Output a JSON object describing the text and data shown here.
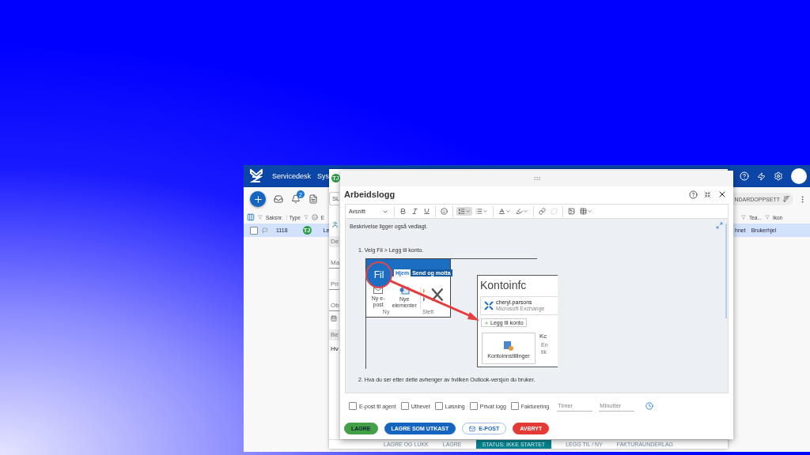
{
  "app": {
    "nav": {
      "title": "Servicedesk",
      "item_2": "Sys"
    },
    "toolbar": {
      "notification_count": "2",
      "layout_button": "NDARDOPPSETT"
    },
    "table": {
      "columns_left": [
        "Saksnr.",
        "Type",
        "E"
      ],
      "columns_right": [
        "Tea...",
        "Ikon"
      ],
      "rows": [
        {
          "selected": true,
          "saksnr": "1118",
          "avatar": "TJ",
          "column_3": "Le",
          "column_4": "hnet",
          "column_5": "Brukerhjel"
        }
      ]
    }
  },
  "case_panel": {
    "avatar": "TJ",
    "slot_label": "SL",
    "rows": [
      {
        "kind": "section",
        "label": "De"
      },
      {
        "kind": "field",
        "label": "Ma"
      },
      {
        "kind": "field",
        "label": "Pri"
      },
      {
        "kind": "field",
        "label": "Ob"
      },
      {
        "kind": "icon-row"
      },
      {
        "kind": "section",
        "label": "Be"
      },
      {
        "kind": "text",
        "label": "Hv"
      }
    ],
    "footer": [
      {
        "kind": "action",
        "label": "LAGRE OG LUKK"
      },
      {
        "kind": "action",
        "label": "LAGRE"
      },
      {
        "kind": "status",
        "label": "STATUS: IKKE STARTET"
      },
      {
        "kind": "action",
        "label": "LEGG TIL / NY"
      },
      {
        "kind": "action",
        "label": "FAKTURAUNDERLAG"
      }
    ]
  },
  "dialog": {
    "title": "Arbeidslogg",
    "block_format": "Avsnitt",
    "toolbar": [
      {
        "kind": "bold",
        "active": false,
        "disabled": false
      },
      {
        "kind": "italic",
        "active": false,
        "disabled": false
      },
      {
        "kind": "underline",
        "active": false,
        "disabled": false
      },
      {
        "kind": "emoji",
        "active": false,
        "disabled": false
      },
      {
        "kind": "ordered-list",
        "active": true,
        "disabled": false
      },
      {
        "kind": "bullet-list",
        "active": false,
        "disabled": false
      },
      {
        "kind": "text-color",
        "active": false,
        "disabled": false
      },
      {
        "kind": "highlight",
        "active": false,
        "disabled": false
      },
      {
        "kind": "link",
        "active": false,
        "disabled": false
      },
      {
        "kind": "unlink",
        "active": false,
        "disabled": true
      },
      {
        "kind": "image",
        "active": false,
        "disabled": false
      },
      {
        "kind": "table",
        "active": false,
        "disabled": false
      }
    ],
    "editor": {
      "intro": "Beskrivelse ligger også vedlagt.",
      "step_1": "1. Velg Fil > Legg til konto.",
      "step_2": "2. Hva du ser etter dette avhenger av hvilken Outlook-versjon du bruker.",
      "screenshot": {
        "file_tab": "Fil",
        "tabs": [
          "Hjem",
          "Send og motta"
        ],
        "ribbon_buttons": [
          "Ny e-post",
          "Nye elementer"
        ],
        "groups": [
          "Ny",
          "Slett"
        ],
        "heading": "Kontoinfc",
        "account_name": "cheryl.parsons",
        "account_type": "Microsoft Exchange",
        "add_account": "Legg til konto",
        "settings_tile": "Kontoinnstillinger",
        "side_title": "Kc",
        "side_text": [
          "En",
          "tik"
        ]
      }
    },
    "options": [
      {
        "label": "E-post til agent",
        "checked": false
      },
      {
        "label": "Uthevet",
        "checked": false
      },
      {
        "label": "Løsning",
        "checked": false
      },
      {
        "label": "Privat logg",
        "checked": false
      },
      {
        "label": "Fakturering",
        "checked": false
      }
    ],
    "time_fields": [
      {
        "placeholder": "Timer"
      },
      {
        "placeholder": "Minutter"
      }
    ],
    "buttons": [
      {
        "kind": "save",
        "label": "LAGRE"
      },
      {
        "kind": "draft",
        "label": "LAGRE SOM UTKAST"
      },
      {
        "kind": "email",
        "label": "E-POST"
      },
      {
        "kind": "cancel",
        "label": "AVBRYT"
      }
    ]
  }
}
